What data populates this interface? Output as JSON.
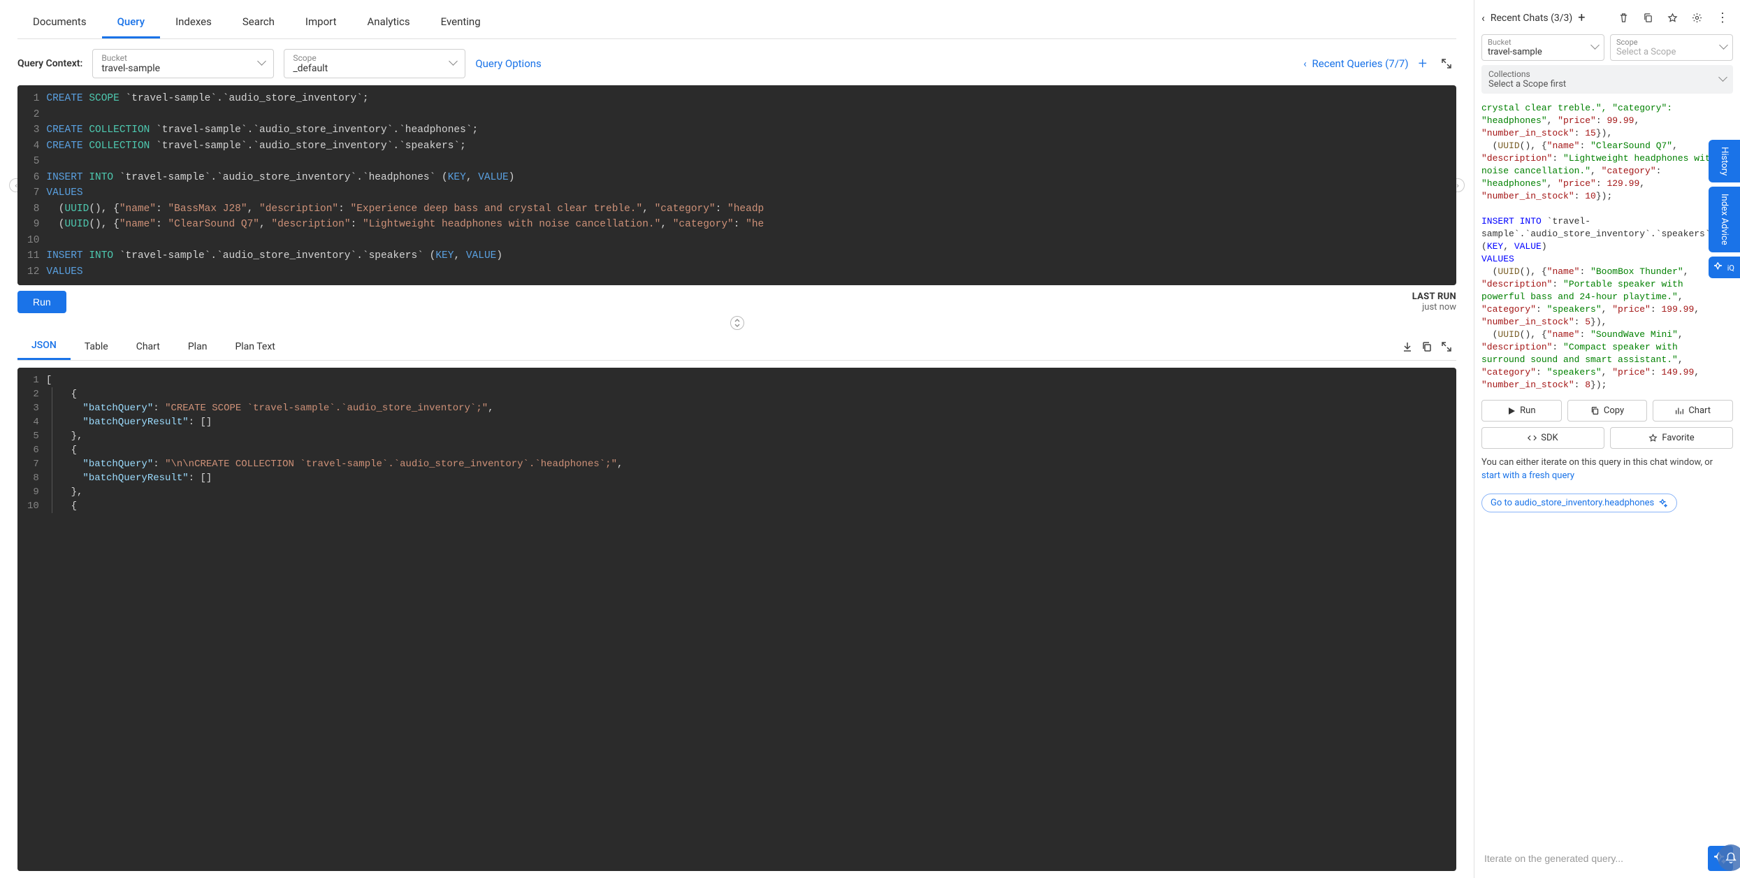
{
  "nav_tabs": [
    "Documents",
    "Query",
    "Indexes",
    "Search",
    "Import",
    "Analytics",
    "Eventing"
  ],
  "active_nav": "Query",
  "query_context": {
    "label": "Query Context:",
    "bucket_label": "Bucket",
    "bucket_value": "travel-sample",
    "scope_label": "Scope",
    "scope_value": "_default"
  },
  "query_options": "Query Options",
  "recent_queries_label": "Recent Queries (7/7)",
  "editor_lines": [
    "1",
    "2",
    "3",
    "4",
    "5",
    "6",
    "7",
    "8",
    "9",
    "10",
    "11",
    "12"
  ],
  "editor_text": {
    "l1_a": "CREATE",
    "l1_b": "SCOPE",
    "l1_c": " `travel-sample`.`audio_store_inventory`;",
    "l3_a": "CREATE",
    "l3_b": "COLLECTION",
    "l3_c": " `travel-sample`.`audio_store_inventory`.`headphones`;",
    "l4_a": "CREATE",
    "l4_b": "COLLECTION",
    "l4_c": " `travel-sample`.`audio_store_inventory`.`speakers`;",
    "l6_a": "INSERT",
    "l6_b": "INTO",
    "l6_c": " `travel-sample`.`audio_store_inventory`.`headphones` (",
    "l6_d": "KEY",
    "l6_e": ", ",
    "l6_f": "VALUE",
    "l6_g": ")",
    "l7": "VALUES",
    "l8_a": "  (",
    "l8_b": "UUID",
    "l8_c": "(), {",
    "l8_d": "\"name\"",
    "l8_e": ": ",
    "l8_f": "\"BassMax J28\"",
    "l8_g": ", ",
    "l8_h": "\"description\"",
    "l8_i": ": ",
    "l8_j": "\"Experience deep bass and crystal clear treble.\"",
    "l8_k": ", ",
    "l8_l": "\"category\"",
    "l8_m": ": ",
    "l8_n": "\"headp",
    "l9_a": "  (",
    "l9_b": "UUID",
    "l9_c": "(), {",
    "l9_d": "\"name\"",
    "l9_e": ": ",
    "l9_f": "\"ClearSound Q7\"",
    "l9_g": ", ",
    "l9_h": "\"description\"",
    "l9_i": ": ",
    "l9_j": "\"Lightweight headphones with noise cancellation.\"",
    "l9_k": ", ",
    "l9_l": "\"category\"",
    "l9_m": ": ",
    "l9_n": "\"he",
    "l11_a": "INSERT",
    "l11_b": "INTO",
    "l11_c": " `travel-sample`.`audio_store_inventory`.`speakers` (",
    "l11_d": "KEY",
    "l11_e": ", ",
    "l11_f": "VALUE",
    "l11_g": ")",
    "l12": "VALUES"
  },
  "run_button": "Run",
  "last_run_label": "LAST RUN",
  "last_run_value": "just now",
  "result_tabs": [
    "JSON",
    "Table",
    "Chart",
    "Plan",
    "Plan Text"
  ],
  "active_result_tab": "JSON",
  "result_lines": [
    "1",
    "2",
    "3",
    "4",
    "5",
    "6",
    "7",
    "8",
    "9",
    "10"
  ],
  "result_text": {
    "l1": "[",
    "l2": "  {",
    "l3_a": "    ",
    "l3_b": "\"batchQuery\"",
    "l3_c": ": ",
    "l3_d": "\"CREATE SCOPE `travel-sample`.`audio_store_inventory`;\"",
    "l3_e": ",",
    "l4_a": "    ",
    "l4_b": "\"batchQueryResult\"",
    "l4_c": ": []",
    "l5": "  },",
    "l6": "  {",
    "l7_a": "    ",
    "l7_b": "\"batchQuery\"",
    "l7_c": ": ",
    "l7_d": "\"\\n\\nCREATE COLLECTION `travel-sample`.`audio_store_inventory`.`headphones`;\"",
    "l7_e": ",",
    "l8_a": "    ",
    "l8_b": "\"batchQueryResult\"",
    "l8_c": ": []",
    "l9": "  },",
    "l10": "  {"
  },
  "sidebar": {
    "recent_chats": "Recent Chats (3/3)",
    "bucket_label": "Bucket",
    "bucket_value": "travel-sample",
    "scope_label": "Scope",
    "scope_placeholder": "Select a Scope",
    "collections_label": "Collections",
    "collections_hint": "Select a Scope first",
    "buttons": {
      "run": "Run",
      "copy": "Copy",
      "chart": "Chart",
      "sdk": "SDK",
      "favorite": "Favorite"
    },
    "note_text": "You can either iterate on this query in this chat window, or ",
    "note_link": "start with a fresh query",
    "goto": "Go to audio_store_inventory.headphones",
    "input_placeholder": "Iterate on the generated query..."
  },
  "sidebar_code": {
    "s1": "crystal clear treble.\", \"category\":",
    "s2_a": "\"headphones\"",
    "s2_b": ", ",
    "s2_c": "\"price\"",
    "s2_d": ": ",
    "s2_e": "99.99",
    "s2_f": ",",
    "s3_a": "\"number_in_stock\"",
    "s3_b": ": ",
    "s3_c": "15",
    "s3_d": "}),",
    "s4_a": "  (",
    "s4_b": "UUID",
    "s4_c": "(), {",
    "s4_d": "\"name\"",
    "s4_e": ": ",
    "s4_f": "\"ClearSound Q7\"",
    "s4_g": ",",
    "s5_a": "\"description\"",
    "s5_b": ": ",
    "s5_c": "\"Lightweight headphones with",
    "s6": "noise cancellation.\"",
    "s6b": ", ",
    "s6c": "\"category\"",
    "s6d": ":",
    "s7_a": "\"headphones\"",
    "s7_b": ", ",
    "s7_c": "\"price\"",
    "s7_d": ": ",
    "s7_e": "129.99",
    "s7_f": ",",
    "s8_a": "\"number_in_stock\"",
    "s8_b": ": ",
    "s8_c": "10",
    "s8_d": "});",
    "blank": "",
    "i1_a": "INSERT INTO",
    "i1_b": " `travel-",
    "i2": "sample`.`audio_store_inventory`.`speakers`",
    "i3_a": "(",
    "i3_b": "KEY",
    "i3_c": ", ",
    "i3_d": "VALUE",
    "i3_e": ")",
    "i4": "VALUES",
    "b1_a": "  (",
    "b1_b": "UUID",
    "b1_c": "(), {",
    "b1_d": "\"name\"",
    "b1_e": ": ",
    "b1_f": "\"BoomBox Thunder\"",
    "b1_g": ",",
    "b2_a": "\"description\"",
    "b2_b": ": ",
    "b2_c": "\"Portable speaker with",
    "b3": "powerful bass and 24-hour playtime.\"",
    "b3b": ",",
    "b4_a": "\"category\"",
    "b4_b": ": ",
    "b4_c": "\"speakers\"",
    "b4_d": ", ",
    "b4_e": "\"price\"",
    "b4_f": ": ",
    "b4_g": "199.99",
    "b4_h": ",",
    "b5_a": "\"number_in_stock\"",
    "b5_b": ": ",
    "b5_c": "5",
    "b5_d": "}),",
    "w1_a": "  (",
    "w1_b": "UUID",
    "w1_c": "(), {",
    "w1_d": "\"name\"",
    "w1_e": ": ",
    "w1_f": "\"SoundWave Mini\"",
    "w1_g": ",",
    "w2_a": "\"description\"",
    "w2_b": ": ",
    "w2_c": "\"Compact speaker with",
    "w3": "surround sound and smart assistant.\"",
    "w3b": ",",
    "w4_a": "\"category\"",
    "w4_b": ": ",
    "w4_c": "\"speakers\"",
    "w4_d": ", ",
    "w4_e": "\"price\"",
    "w4_f": ": ",
    "w4_g": "149.99",
    "w4_h": ",",
    "w5_a": "\"number_in_stock\"",
    "w5_b": ": ",
    "w5_c": "8",
    "w5_d": "});"
  },
  "rail": {
    "history": "History",
    "index_advice": "Index Advice",
    "iq": "iQ"
  }
}
